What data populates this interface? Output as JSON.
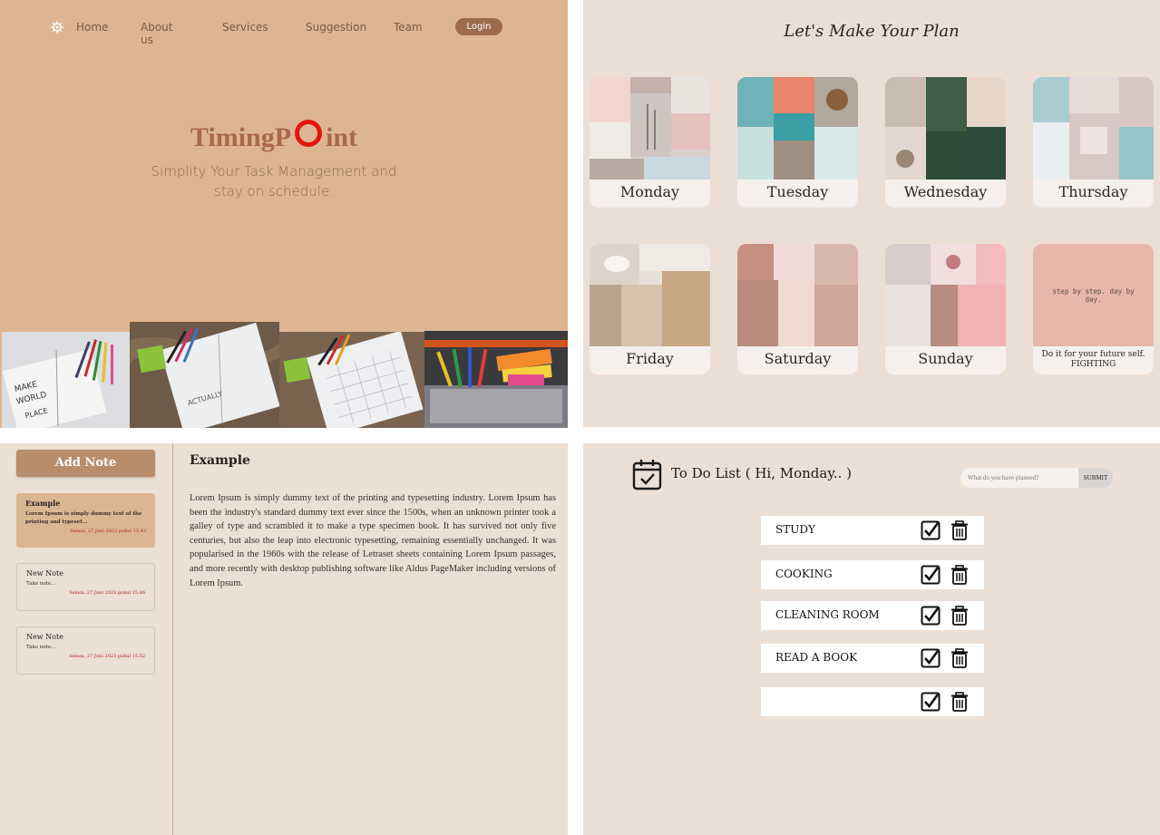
{
  "landing": {
    "nav": [
      "Home",
      "About us",
      "Services",
      "Suggestion",
      "Team"
    ],
    "login_label": "Login",
    "brand_before": "TimingP",
    "brand_after": "int",
    "tagline": "Simplity Your Task Management and stay on schedule.",
    "colors": {
      "background": "#deb592",
      "accent": "#9c6a4e",
      "brand": "#a6694a",
      "ring": "#e5140f"
    }
  },
  "plan": {
    "title": "Let's Make Your Plan",
    "days": [
      "Monday",
      "Tuesday",
      "Wednesday",
      "Thursday",
      "Friday",
      "Saturday",
      "Sunday"
    ],
    "quote_card": {
      "quote": "step by step. day by day.",
      "caption": "Do it for your future self. FIGHTING"
    }
  },
  "notes": {
    "add_label": "Add Note",
    "items": [
      {
        "title": "Example",
        "body": "Lorem Ipsum is simply dummy text of the printing and typeset...",
        "date": "Selasa, 27 Juni 2023 pukul 15.43"
      },
      {
        "title": "New Note",
        "body": "Take note...",
        "date": "Selasa, 27 Juni 2023 pukul 15.46"
      },
      {
        "title": "New Note",
        "body": "Take note...",
        "date": "Selasa, 27 Juni 2023 pukul 15.52"
      }
    ],
    "editor": {
      "title": "Example",
      "body": "Lorem Ipsum is simply dummy text of the printing and typesetting industry. Lorem Ipsum has been the industry's standard dummy text ever since the 1500s, when an unknown printer took a galley of type and scrambled it to make a type specimen book. It has survived not only five centuries, but also the leap into electronic typesetting, remaining essentially unchanged. It was popularised in the 1960s with the release of Letraset sheets containing Lorem Ipsum passages, and more recently with desktop publishing software like Aldus PageMaker including versions of Lorem Ipsum."
    }
  },
  "todo": {
    "title": "To Do List ( Hi, Monday.. )",
    "search_placeholder": "What do you have planned?",
    "submit_label": "SUBMIT",
    "items": [
      "STUDY",
      "COOKING",
      "CLEANING ROOM",
      "READ A BOOK",
      ""
    ]
  }
}
